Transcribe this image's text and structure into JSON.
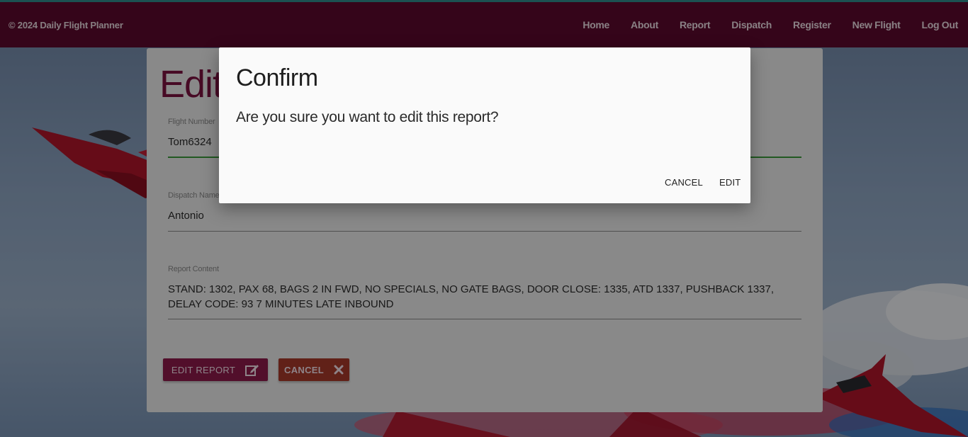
{
  "navbar": {
    "brand": "© 2024 Daily Flight Planner",
    "links": [
      "Home",
      "About",
      "Report",
      "Dispatch",
      "Register",
      "New Flight",
      "Log Out"
    ]
  },
  "form": {
    "title": "Edit",
    "fields": {
      "flight_number": {
        "label": "Flight Number",
        "value": "Tom6324"
      },
      "dispatch_name": {
        "label": "Dispatch Name",
        "value": "Antonio"
      },
      "report_content": {
        "label": "Report Content",
        "value": "STAND: 1302, PAX 68, BAGS 2 IN FWD, NO SPECIALS, NO GATE BAGS, DOOR CLOSE: 1335, ATD 1337, PUSHBACK 1337, DELAY CODE: 93 7 MINUTES LATE INBOUND"
      }
    },
    "edit_button": "EDIT REPORT",
    "cancel_button": "CANCEL"
  },
  "modal": {
    "title": "Confirm",
    "message": "Are you sure you want to edit this report?",
    "cancel": "CANCEL",
    "confirm": "EDIT"
  },
  "colors": {
    "navbar": "#5c0a2e",
    "accent": "#7a1240",
    "edit_button": "#8e1a4b",
    "cancel_button": "#a8392a",
    "active_field_line": "#3a9a3a"
  },
  "icons": {
    "edit_button_icon": "edit-square-icon",
    "cancel_button_icon": "close-x-icon"
  }
}
